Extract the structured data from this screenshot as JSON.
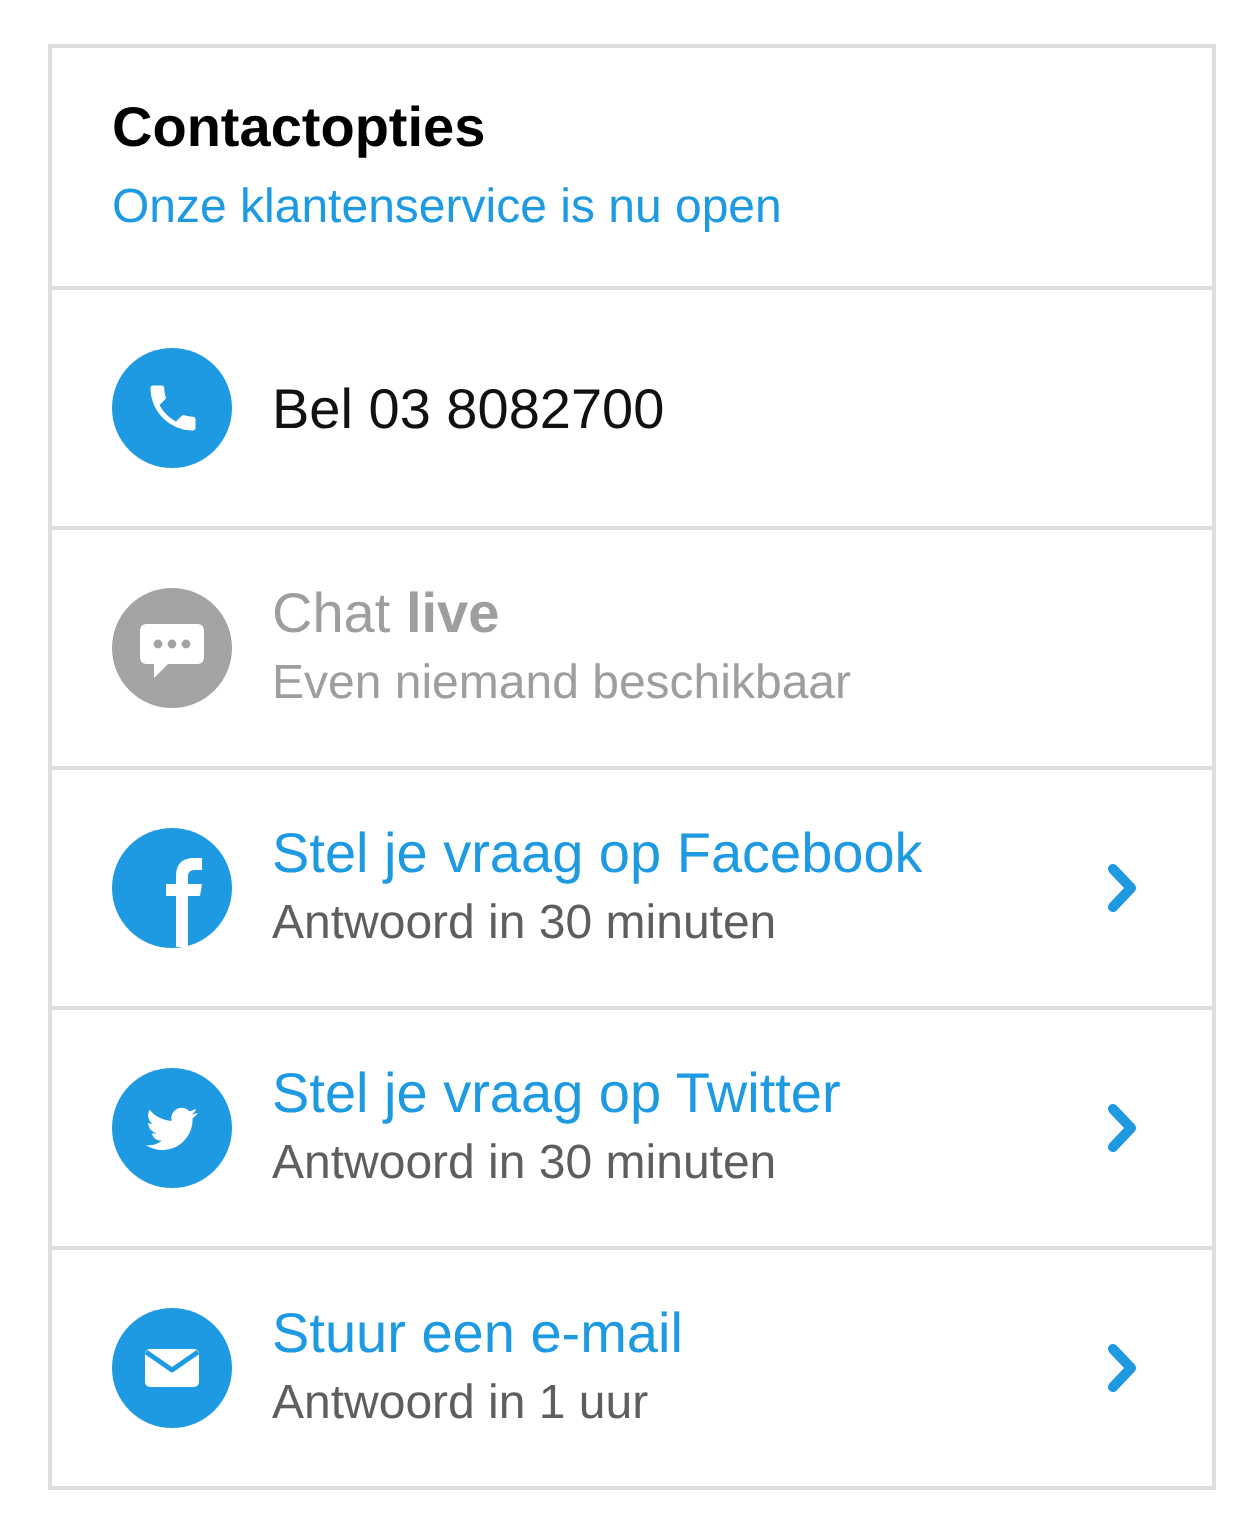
{
  "header": {
    "title": "Contactopties",
    "status": "Onze klantenservice is nu open"
  },
  "options": [
    {
      "kind": "phone",
      "title": "Bel 03 8082700",
      "disabled": false,
      "link": false
    },
    {
      "kind": "chat",
      "title": "Chat **live**",
      "subtitle": "Even niemand beschikbaar",
      "disabled": true,
      "link": false
    },
    {
      "kind": "facebook",
      "title": "Stel je vraag op Facebook",
      "subtitle": "Antwoord in 30 minuten",
      "disabled": false,
      "link": true
    },
    {
      "kind": "twitter",
      "title": "Stel je vraag op Twitter",
      "subtitle": "Antwoord in 30 minuten",
      "disabled": false,
      "link": true
    },
    {
      "kind": "mail",
      "title": "Stuur een e-mail",
      "subtitle": "Antwoord in 1 uur",
      "disabled": false,
      "link": true
    }
  ]
}
